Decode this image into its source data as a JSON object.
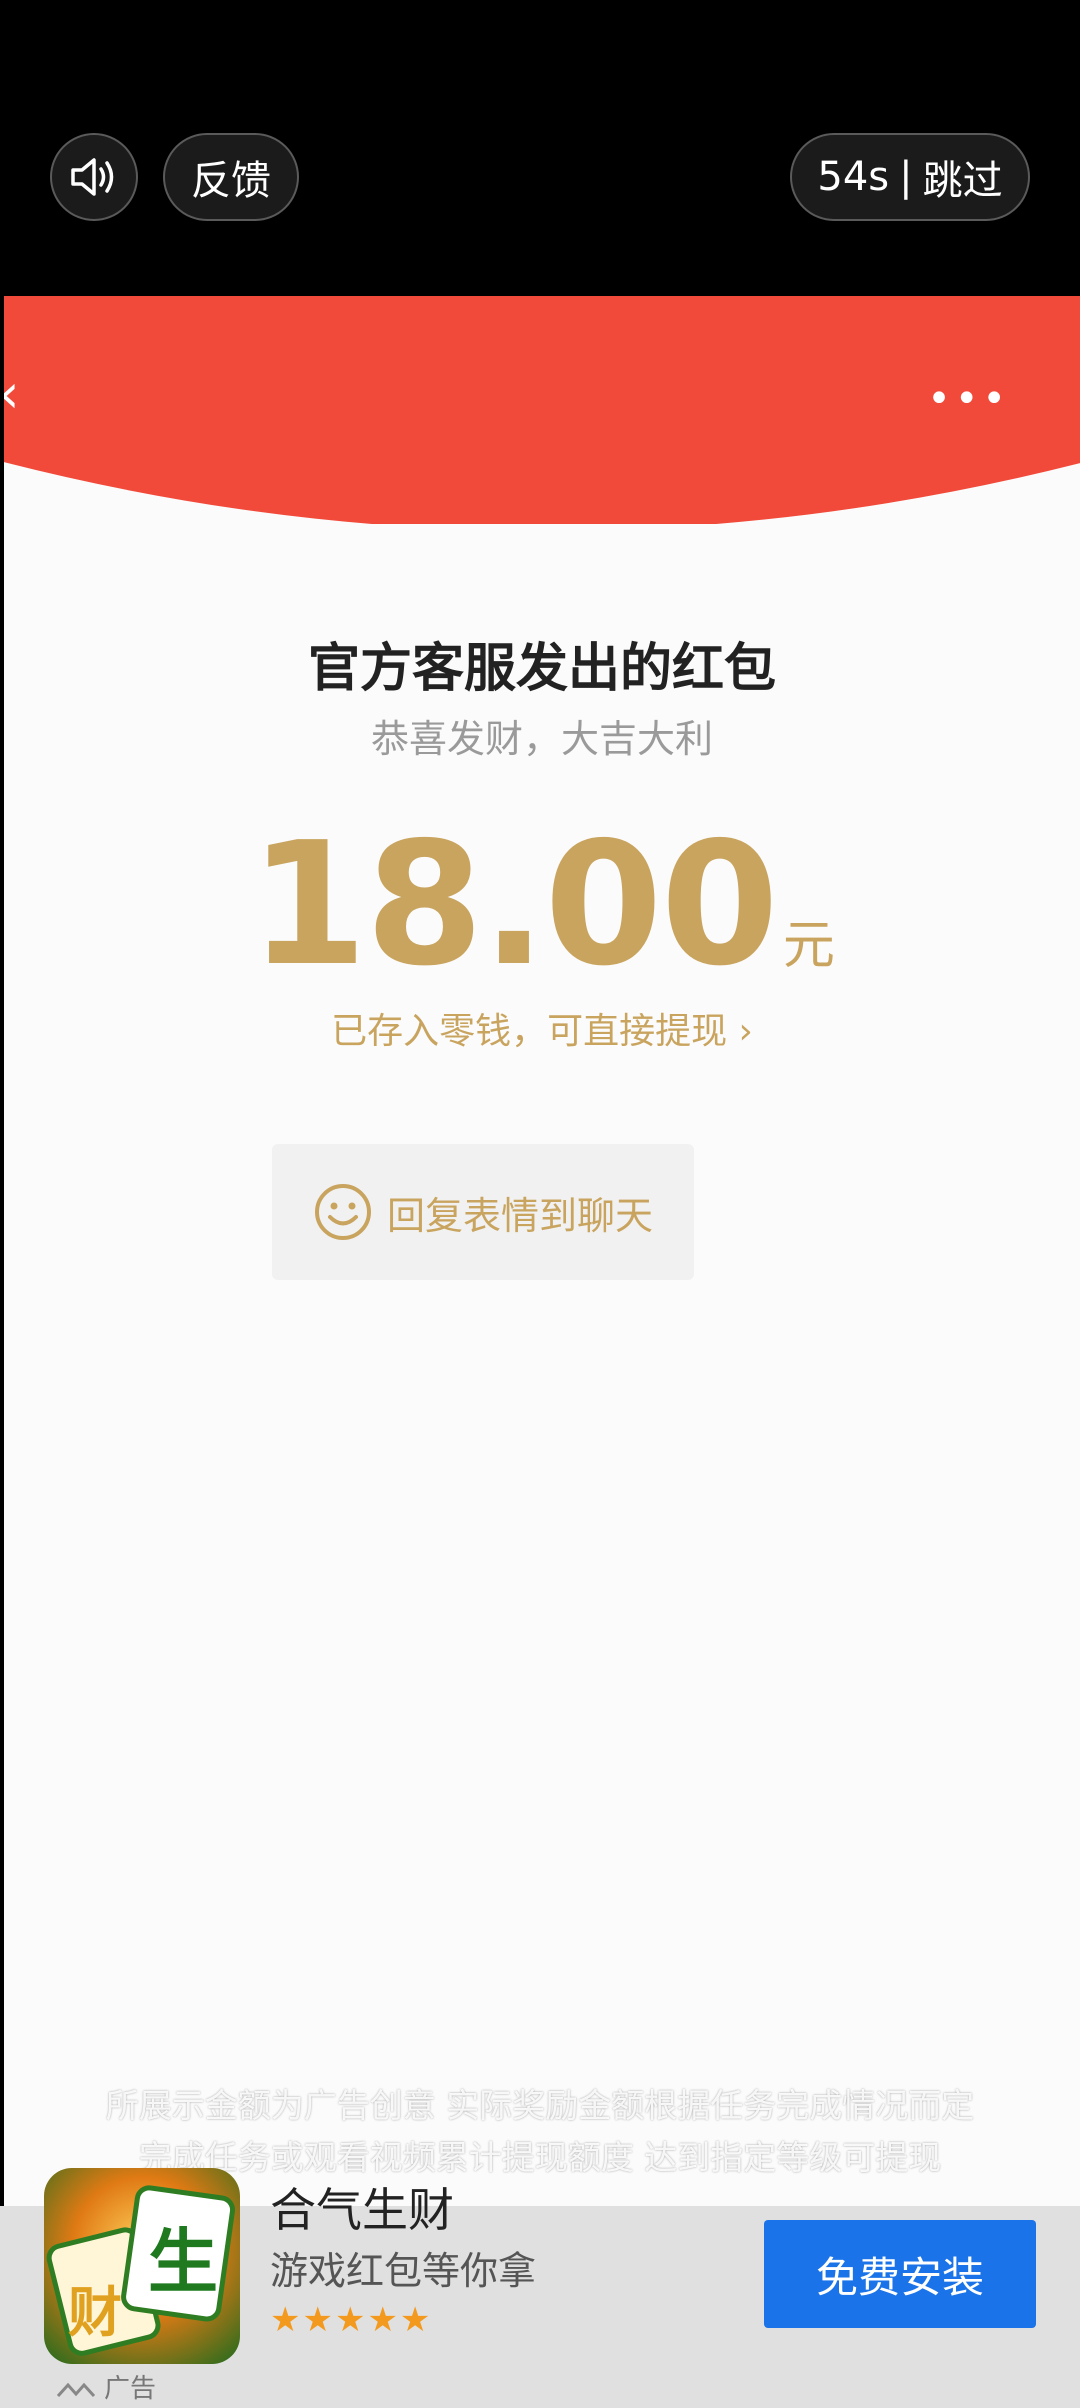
{
  "top_bar": {
    "feedback_label": "反馈",
    "countdown": "54s",
    "skip_label": "跳过"
  },
  "video": {
    "menu_dots": "•••",
    "title": "官方客服发出的红包",
    "subtitle": "恭喜发财，大吉大利",
    "amount": "18.00",
    "unit": "元",
    "deposit_text": "已存入零钱，可直接提现 ›",
    "reply_label": "回复表情到聊天"
  },
  "disclaimer": {
    "line1": "所展示金额为广告创意 实际奖励金额根据任务完成情况而定",
    "line2": "完成任务或观看视频累计提现额度 达到指定等级可提现"
  },
  "ad": {
    "app_name": "合气生财",
    "app_desc": "游戏红包等你拿",
    "stars": "★★★★★",
    "install_label": "免费安装",
    "ad_label": "广告",
    "icon_chars": {
      "a": "生",
      "b": "财"
    }
  },
  "colors": {
    "red_banner": "#f24a3a",
    "gold": "#c9a45f",
    "install_blue": "#1a73e8"
  }
}
